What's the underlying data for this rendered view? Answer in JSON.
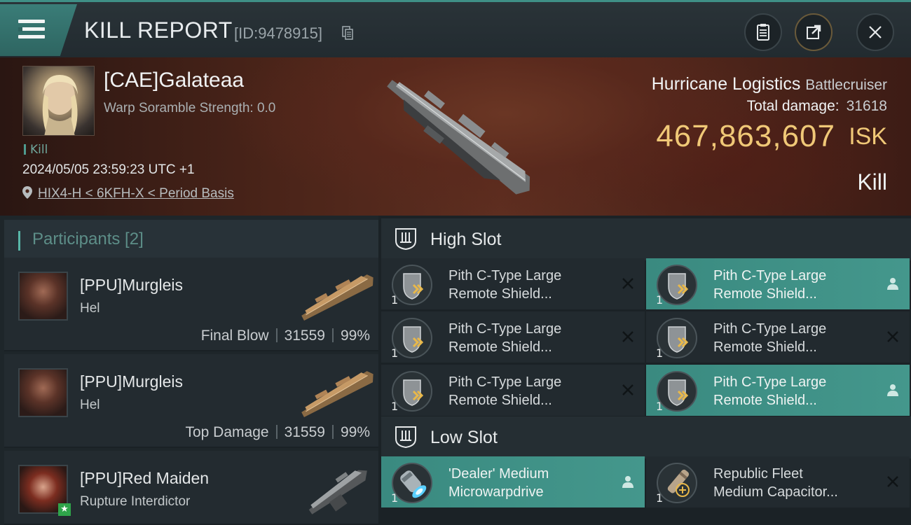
{
  "header": {
    "title": "KILL REPORT",
    "report_id": "[ID:9478915]"
  },
  "victim": {
    "pilot": "[CAE]Galateaa",
    "warp_scramble": "Warp Soramble Strength: 0.0",
    "tag": "Kill",
    "timestamp": "2024/05/05 23:59:23 UTC +1",
    "location": "HIX4-H < 6KFH-X < Period Basis",
    "ship_name": "Hurricane Logistics",
    "ship_class": "Battlecruiser",
    "total_damage_label": "Total damage:",
    "total_damage": "31618",
    "isk_value": "467,863,607",
    "isk_unit": "ISK",
    "result": "Kill"
  },
  "participants": {
    "title": "Participants [2]",
    "items": [
      {
        "name": "[PPU]Murgleis",
        "ship": "Hel",
        "role": "Final Blow",
        "damage": "31559",
        "percent": "99%"
      },
      {
        "name": "[PPU]Murgleis",
        "ship": "Hel",
        "role": "Top Damage",
        "damage": "31559",
        "percent": "99%"
      },
      {
        "name": "[PPU]Red Maiden",
        "ship": "Rupture Interdictor",
        "role": "",
        "damage": "",
        "percent": ""
      }
    ]
  },
  "slots": {
    "high": {
      "title": "High Slot",
      "modules": [
        {
          "line1": "Pith C-Type Large",
          "line2": "Remote Shield...",
          "qty": "1",
          "state": "destroyed",
          "highlight": false
        },
        {
          "line1": "Pith C-Type Large",
          "line2": "Remote Shield...",
          "qty": "1",
          "state": "dropped",
          "highlight": true
        },
        {
          "line1": "Pith C-Type Large",
          "line2": "Remote Shield...",
          "qty": "1",
          "state": "destroyed",
          "highlight": false
        },
        {
          "line1": "Pith C-Type Large",
          "line2": "Remote Shield...",
          "qty": "1",
          "state": "destroyed",
          "highlight": false
        },
        {
          "line1": "Pith C-Type Large",
          "line2": "Remote Shield...",
          "qty": "1",
          "state": "destroyed",
          "highlight": false
        },
        {
          "line1": "Pith C-Type Large",
          "line2": "Remote Shield...",
          "qty": "1",
          "state": "dropped",
          "highlight": true
        }
      ]
    },
    "low": {
      "title": "Low Slot",
      "modules": [
        {
          "line1": "'Dealer' Medium",
          "line2": "Microwarpdrive",
          "qty": "1",
          "state": "dropped",
          "highlight": true
        },
        {
          "line1": "Republic Fleet",
          "line2": "Medium Capacitor...",
          "qty": "1",
          "state": "destroyed",
          "highlight": false
        }
      ]
    }
  },
  "colors": {
    "accent": "#44978c",
    "isk": "#f0c877"
  },
  "icons": [
    "menu-icon",
    "copy-icon",
    "clipboard-icon",
    "share-icon",
    "close-icon",
    "location-pin-icon",
    "high-slot-icon",
    "low-slot-icon",
    "destroyed-x-icon",
    "dropped-person-icon"
  ]
}
